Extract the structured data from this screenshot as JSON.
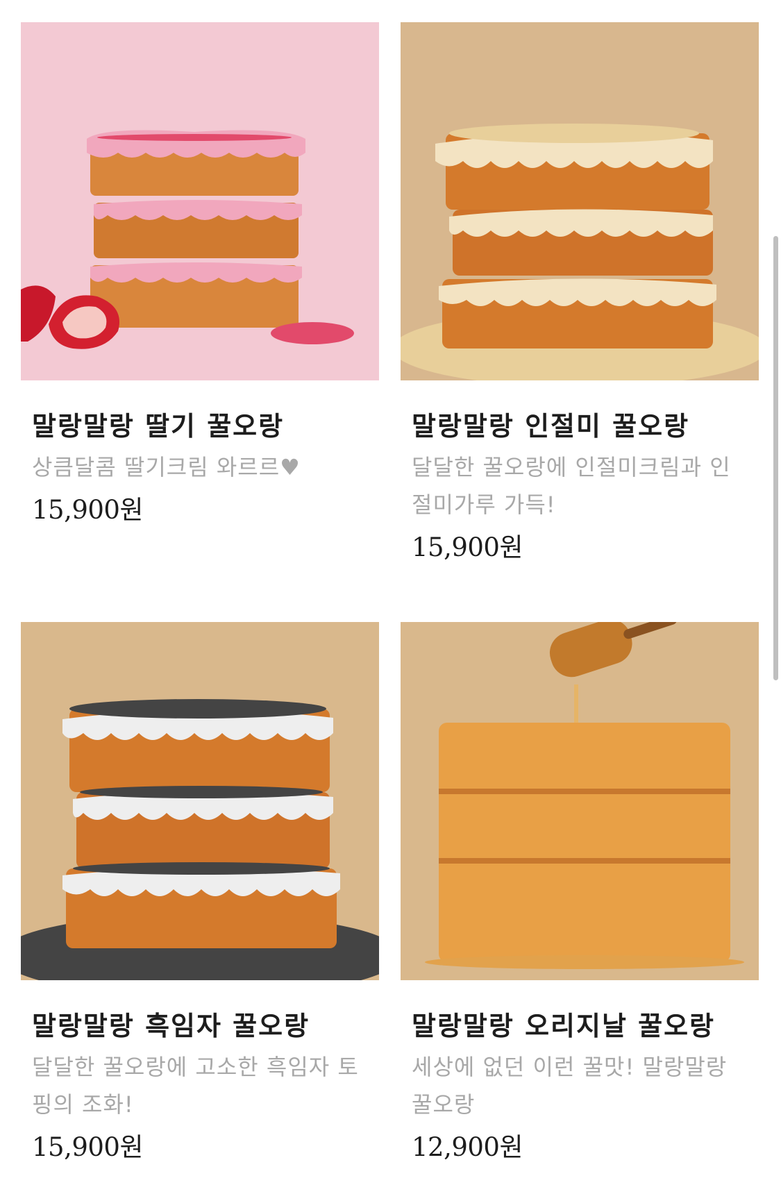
{
  "products": [
    {
      "name": "말랑말랑 딸기 꿀오랑",
      "description": "상큼달콤 딸기크림 와르르♥",
      "price": "15,900원",
      "image_bg": "#f3c9d3",
      "topping_color": "#f1a7bd",
      "sprinkle_color": "#e24a6b"
    },
    {
      "name": "말랑말랑 인절미 꿀오랑",
      "description": "달달한 꿀오랑에 인절미크림과 인절미가루 가득!",
      "price": "15,900원",
      "image_bg": "#d8b78e",
      "topping_color": "#f3e3c2",
      "sprinkle_color": "#e8cf9a"
    },
    {
      "name": "말랑말랑 흑임자 꿀오랑",
      "description": "달달한 꿀오랑에 고소한 흑임자 토핑의 조화!",
      "price": "15,900원",
      "image_bg": "#d9b88c",
      "topping_color": "#eeeeee",
      "sprinkle_color": "#444444"
    },
    {
      "name": "말랑말랑 오리지날 꿀오랑",
      "description": "세상에 없던 이런 꿀맛! 말랑말랑 꿀오랑",
      "price": "12,900원",
      "image_bg": "#d9b88c",
      "topping_color": "#e8a046",
      "sprinkle_color": "#e2a24c"
    }
  ]
}
